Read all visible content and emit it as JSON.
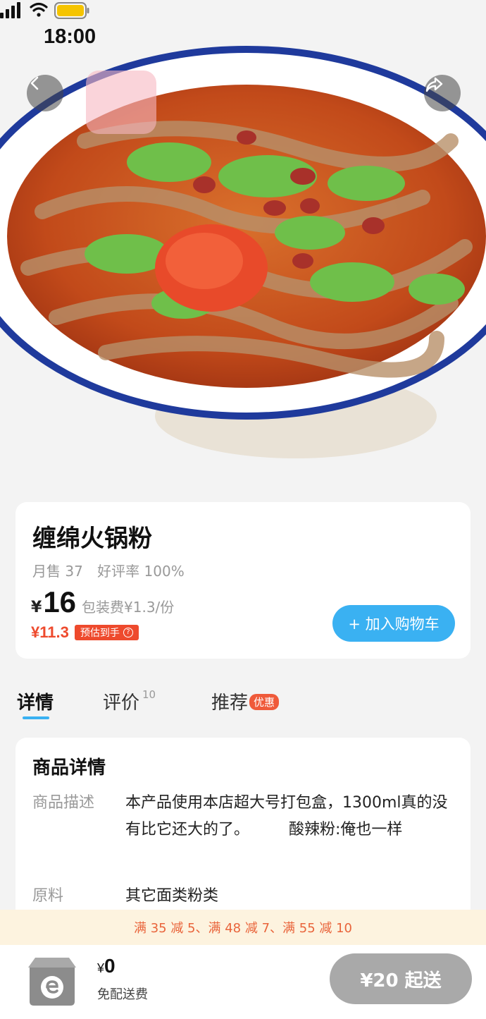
{
  "status_bar": {
    "time": "18:00"
  },
  "product": {
    "name": "缠绵火锅粉",
    "monthly_sales": "月售 37",
    "positive_rate": "好评率 100%",
    "currency_symbol": "¥",
    "price": "16",
    "packaging_fee": "包装费¥1.3/份",
    "estimated_price": "¥11.3",
    "estimated_badge": "预估到手",
    "estimated_badge_icon": "?",
    "add_to_cart_label": "+ 加入购物车"
  },
  "tabs": [
    {
      "label": "详情",
      "active": true
    },
    {
      "label": "评价",
      "count": "10"
    },
    {
      "label": "推荐",
      "badge": "优惠"
    }
  ],
  "details": {
    "title": "商品详情",
    "description_label": "商品描述",
    "description_value": "本产品使用本店超大号打包盒，1300ml真的没有比它还大的了。        酸辣粉:俺也一样",
    "material_label": "原料",
    "material_value": "其它面类粉类"
  },
  "promotion": "满 35 减 5、满 48 减 7、满 55 减 10",
  "cart": {
    "currency_symbol": "¥",
    "amount": "0",
    "delivery_note": "免配送费",
    "min_order_label": "¥20 起送"
  },
  "colors": {
    "accent": "#3ab1f2",
    "price_red": "#ee4a2d",
    "disabled": "#a9a9a9",
    "promo_bg": "#fdf3df"
  }
}
